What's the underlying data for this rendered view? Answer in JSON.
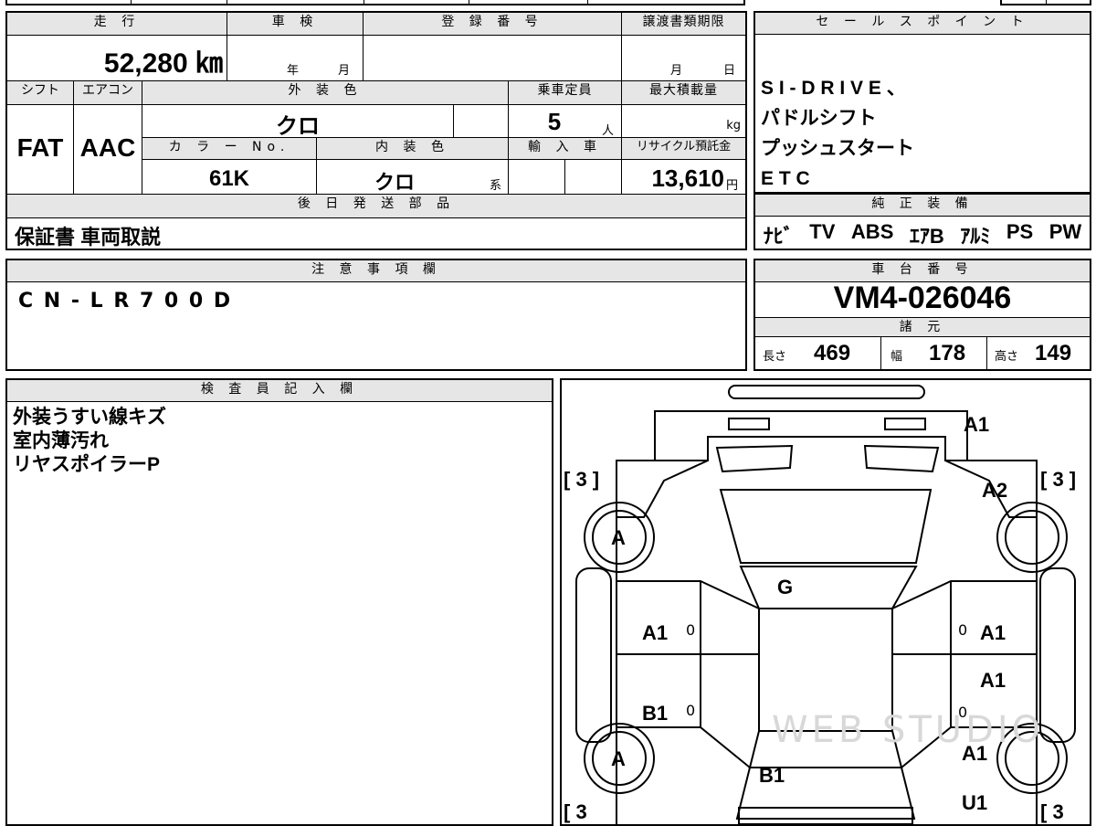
{
  "spec_table": {
    "mileage_header": "走 行",
    "mileage": "52,280 ㎞",
    "inspection_header": "車 検",
    "inspection_year_unit": "年",
    "inspection_month_unit": "月",
    "registration_header": "登 録 番 号",
    "transfer_header": "譲渡書類期限",
    "transfer_month_unit": "月",
    "transfer_day_unit": "日",
    "shift_header": "シフト",
    "ac_header": "エアコン",
    "exterior_color_header": "外 装 色",
    "capacity_header": "乗車定員",
    "max_load_header": "最大積載量",
    "shift": "FAT",
    "ac": "AAC",
    "exterior_color": "クロ",
    "capacity": "5",
    "capacity_unit": "人",
    "max_load_unit": "kg",
    "color_no_header": "カ ラ ー No.",
    "interior_color_header": "内 装 色",
    "import_header": "輸 入 車",
    "recycle_header": "リサイクル預託金",
    "color_no": "61K",
    "interior_color": "クロ",
    "interior_color_suffix": "系",
    "recycle_fee": "13,610",
    "recycle_unit": "円",
    "later_parts_header": "後 日 発 送 部 品",
    "later_parts": "保証書 車両取説"
  },
  "sales_points": {
    "header": "セ ー ル ス ポ イ ン ト",
    "lines": [
      "S I - D R I V E 、",
      "パドルシフト",
      "プッシュスタート",
      "E T C"
    ]
  },
  "genuine_equipment": {
    "header": "純 正 装 備",
    "items": [
      "ﾅﾋﾞ",
      "TV",
      "ABS",
      "ｴｱB",
      "ｱﾙﾐ",
      "PS",
      "PW"
    ]
  },
  "notes": {
    "header": "注 意 事 項 欄",
    "text": "C N - L R 7 0 0 D"
  },
  "chassis": {
    "header": "車 台 番 号",
    "number": "VM4-026046",
    "specs_header": "諸 元",
    "length_label": "長さ",
    "length": "469",
    "width_label": "幅",
    "width": "178",
    "height_label": "高さ",
    "height": "149"
  },
  "inspector": {
    "header": "検 査 員 記 入 欄",
    "lines": [
      "外装うすい線キズ",
      "室内薄汚れ",
      "リヤスポイラーP"
    ]
  },
  "diagram": {
    "tire_left_top": "[ 3 ]",
    "tire_right_top": "[ 3 ]",
    "tire_left_bottom": "[ 3",
    "tire_right_bottom": "[ 3",
    "wheel_fl": "A",
    "wheel_rl": "A",
    "front_bumper": "A1",
    "right_fender": "A2",
    "hood": "G",
    "left_front_door": "A1",
    "left_front_door_num": "0",
    "left_rear_door": "B1",
    "left_rear_door_num": "0",
    "right_front_door_num": "0",
    "right_front_door": "A1",
    "right_rear_door": "A1",
    "right_rear_door_num": "0",
    "right_rear_quarter": "A1",
    "roof": "B1",
    "rear_right": "U1",
    "watermark": "WEB STUDIO"
  }
}
